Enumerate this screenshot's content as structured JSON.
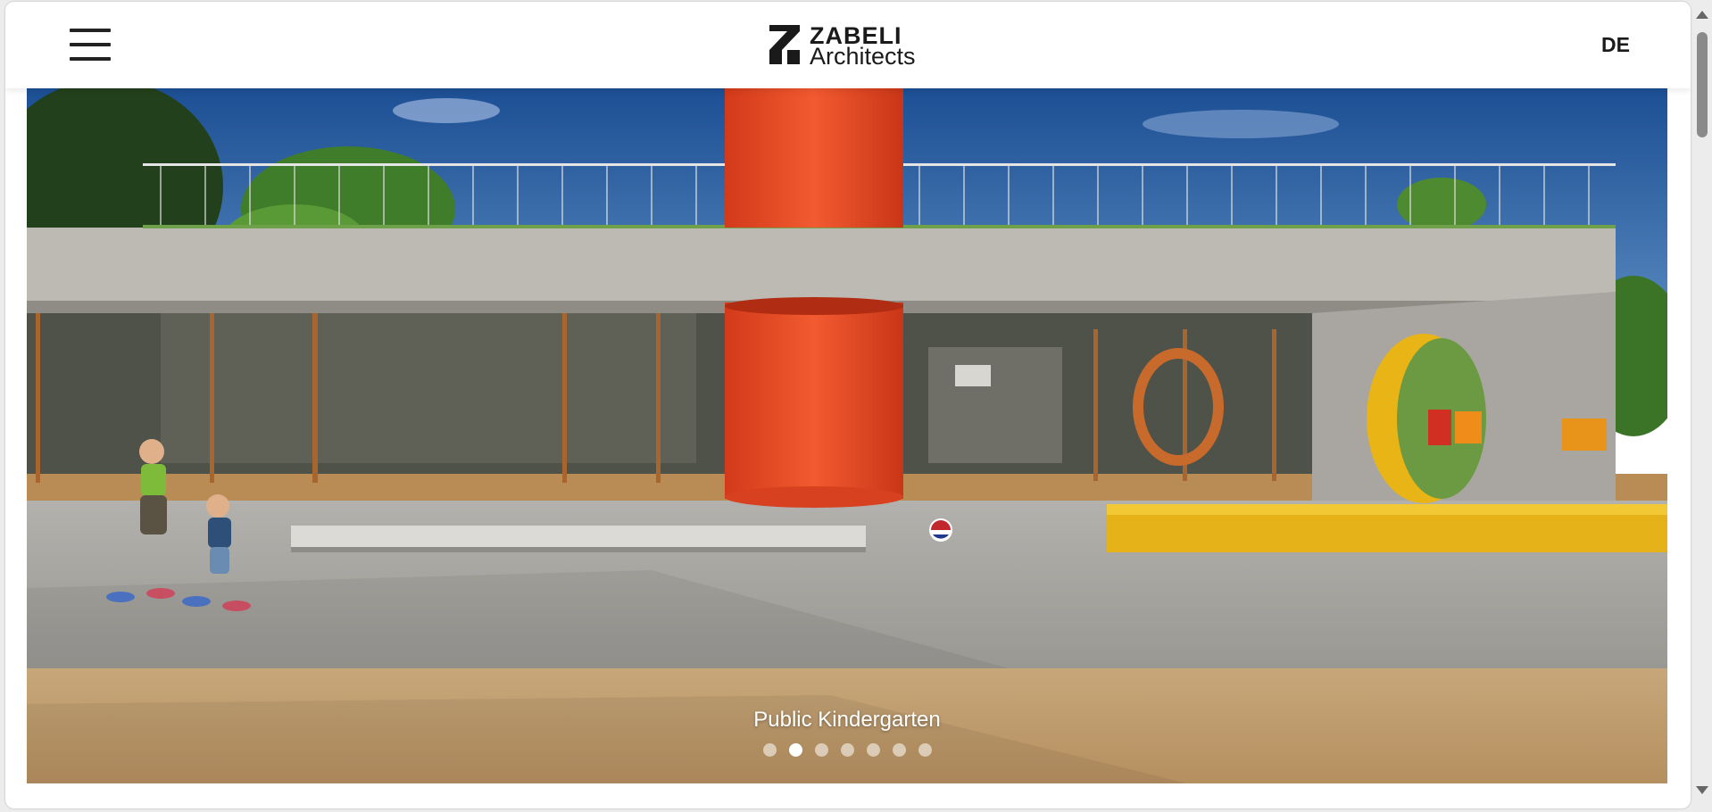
{
  "header": {
    "logo": {
      "line1": "ZABELI",
      "line2": "Architects"
    },
    "language": "DE",
    "menu_icon": "hamburger-menu-icon"
  },
  "slider": {
    "caption": "Public Kindergarten",
    "slide_count": 7,
    "active_index": 1
  },
  "colors": {
    "header_bg": "#ffffff",
    "text": "#1a1a1a",
    "accent_red": "#ef4a25",
    "accent_yellow": "#e8b416"
  }
}
